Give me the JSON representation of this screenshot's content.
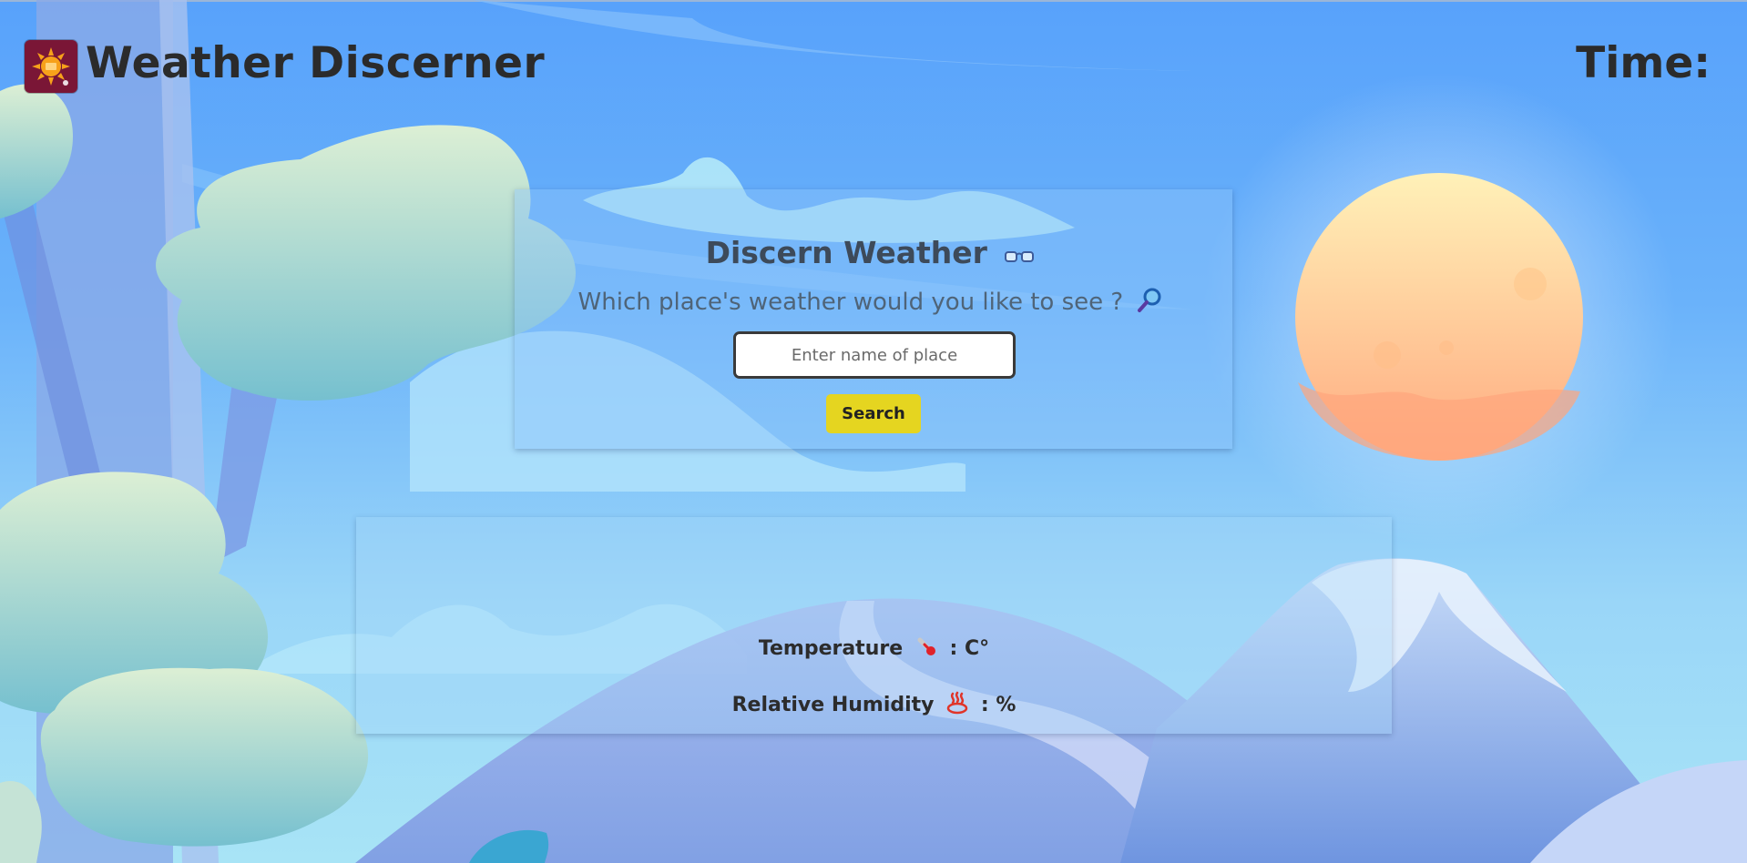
{
  "header": {
    "app_title": "Weather Discerner",
    "time_label": "Time:",
    "logo_icon": "sun-logo-icon"
  },
  "search_card": {
    "title": "Discern Weather",
    "title_icon": "glasses-icon",
    "subtitle": "Which place's weather would you like to see ?",
    "subtitle_icon": "magnifier-icon",
    "input": {
      "value": "",
      "placeholder": "Enter name of place"
    },
    "search_button_label": "Search"
  },
  "result_card": {
    "temperature": {
      "label": "Temperature",
      "icon": "thermometer-icon",
      "value_text": ": C°"
    },
    "humidity": {
      "label": "Relative Humidity",
      "icon": "hot-springs-icon",
      "value_text": ": %"
    }
  },
  "colors": {
    "sky_top": "#58a2fb",
    "sky_bottom": "#a8e4f6",
    "search_button": "#e5d520",
    "logo_background": "#7a1636",
    "title_text": "#2b2b2b"
  }
}
